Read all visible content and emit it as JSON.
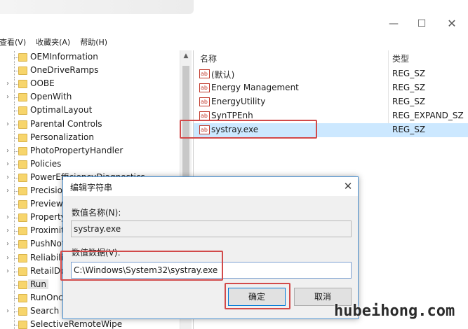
{
  "window": {
    "controls": {
      "minimize": "—",
      "maximize": "☐",
      "close": "✕"
    }
  },
  "menu": {
    "items": [
      "查看(V)",
      "收藏夹(A)",
      "帮助(H)"
    ]
  },
  "tree": {
    "items": [
      {
        "label": "OEMInformation",
        "expander": ""
      },
      {
        "label": "OneDriveRamps",
        "expander": ""
      },
      {
        "label": "OOBE",
        "expander": "›"
      },
      {
        "label": "OpenWith",
        "expander": "›"
      },
      {
        "label": "OptimalLayout",
        "expander": ""
      },
      {
        "label": "Parental Controls",
        "expander": "›"
      },
      {
        "label": "Personalization",
        "expander": ""
      },
      {
        "label": "PhotoPropertyHandler",
        "expander": "›"
      },
      {
        "label": "Policies",
        "expander": "›"
      },
      {
        "label": "PowerEfficiencyDiagnostics",
        "expander": "›"
      },
      {
        "label": "PrecisionTouchPad",
        "expander": "›"
      },
      {
        "label": "PreviewHandlers",
        "expander": ""
      },
      {
        "label": "PropertySystem",
        "expander": "›"
      },
      {
        "label": "Proximity",
        "expander": "›"
      },
      {
        "label": "PushNotifications",
        "expander": "›"
      },
      {
        "label": "Reliability",
        "expander": "›"
      },
      {
        "label": "RetailDemo",
        "expander": "›"
      },
      {
        "label": "Run",
        "expander": "",
        "selected": true
      },
      {
        "label": "RunOnce",
        "expander": ""
      },
      {
        "label": "Search",
        "expander": "›"
      },
      {
        "label": "SelectiveRemoteWipe",
        "expander": ""
      }
    ]
  },
  "values": {
    "columns": {
      "name": "名称",
      "type": "类型"
    },
    "rows": [
      {
        "icon": "ab",
        "name": "(默认)",
        "type": "REG_SZ"
      },
      {
        "icon": "ab",
        "name": "Energy Management",
        "type": "REG_SZ"
      },
      {
        "icon": "ab",
        "name": "EnergyUtility",
        "type": "REG_SZ"
      },
      {
        "icon": "ab",
        "name": "SynTPEnh",
        "type": "REG_EXPAND_SZ"
      },
      {
        "icon": "ab",
        "name": "systray.exe",
        "type": "REG_SZ",
        "selected": true
      }
    ]
  },
  "dialog": {
    "title": "编辑字符串",
    "close": "✕",
    "name_label": "数值名称(N):",
    "name_value": "systray.exe",
    "data_label": "数值数据(V):",
    "data_value": "C:\\Windows\\System32\\systray.exe",
    "ok": "确定",
    "cancel": "取消"
  },
  "watermark": "hubeihong.com",
  "colors": {
    "highlight": "#d24a4a",
    "selection": "#cce8ff",
    "folder": "#f7d56c"
  }
}
